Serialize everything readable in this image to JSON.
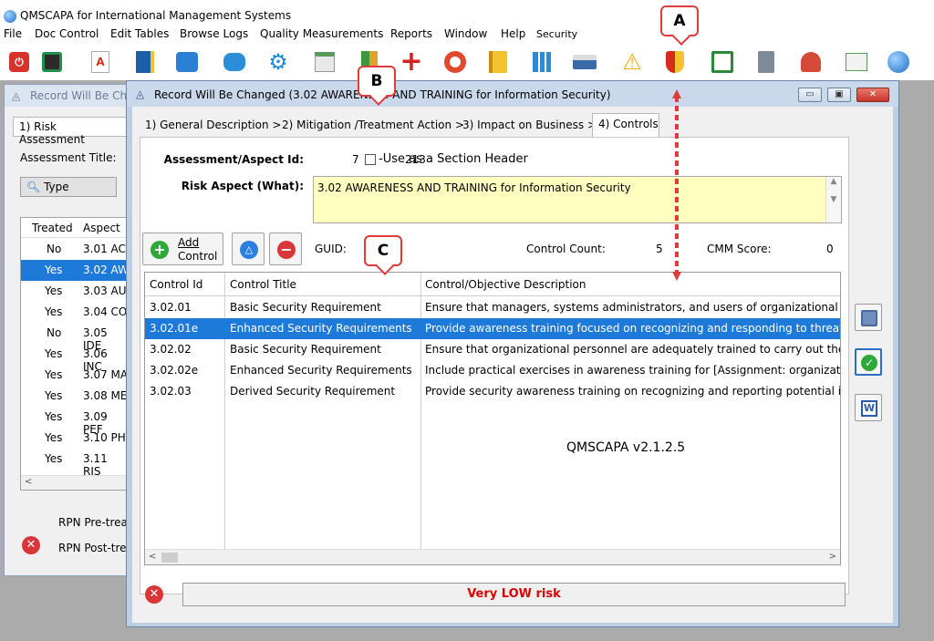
{
  "app": {
    "title": "QMSCAPA for International Management Systems",
    "version": "QMSCAPA v2.1.2.5"
  },
  "menu": [
    {
      "label": "File"
    },
    {
      "label": "Doc Control"
    },
    {
      "label": "Edit Tables"
    },
    {
      "label": "Browse Logs"
    },
    {
      "label": "Quality Measurements"
    },
    {
      "label": "Reports"
    },
    {
      "label": "Window"
    },
    {
      "label": "Help"
    },
    {
      "label": "Security"
    }
  ],
  "toolbar_icons": [
    "power-icon",
    "document-list-icon",
    "pdf-icon",
    "notebook-icon",
    "org-chart-icon",
    "chat-icon",
    "gear-icon",
    "calendar-icon",
    "books-icon",
    "red-cross-icon",
    "lifebuoy-icon",
    "notepad-icon",
    "bar-chart-icon",
    "printer-icon",
    "warning-icon",
    "shield-icon",
    "checklist-icon",
    "server-icon",
    "user-icon",
    "line-chart-icon",
    "globe-icon"
  ],
  "back_window": {
    "title": "Record Will Be Chan",
    "tab": "1) Risk Assessment",
    "assessment_title_label": "Assessment Title:",
    "type_button": "Type",
    "columns": [
      "Treated",
      "Aspect"
    ],
    "rows": [
      {
        "treated": "No",
        "aspect": "3.01 AC"
      },
      {
        "treated": "Yes",
        "aspect": "3.02 AW"
      },
      {
        "treated": "Yes",
        "aspect": "3.03 AU"
      },
      {
        "treated": "Yes",
        "aspect": "3.04 CO"
      },
      {
        "treated": "No",
        "aspect": "3.05 IDE"
      },
      {
        "treated": "Yes",
        "aspect": "3.06 INC"
      },
      {
        "treated": "Yes",
        "aspect": "3.07 MA"
      },
      {
        "treated": "Yes",
        "aspect": "3.08 ME"
      },
      {
        "treated": "Yes",
        "aspect": "3.09 PEF"
      },
      {
        "treated": "Yes",
        "aspect": "3.10 PH"
      },
      {
        "treated": "Yes",
        "aspect": "3.11 RIS"
      }
    ],
    "rpn_pre": "RPN Pre-trea",
    "rpn_post": "RPN Post-tre"
  },
  "front_window": {
    "title": "Record Will Be Changed  (3.02 AWARENESS AND TRAINING for Information Security)",
    "tabs": [
      {
        "label": "1) General Description >"
      },
      {
        "label": "2) Mitigation /Treatment Action >"
      },
      {
        "label": "3) Impact on Business >"
      },
      {
        "label": "4) Controls"
      }
    ],
    "assessment_id_label": "Assessment/Aspect Id:",
    "assessment_id": "7",
    "aspect_id": "213",
    "section_header_label": "-Use as a Section Header",
    "risk_aspect_label": "Risk Aspect (What):",
    "risk_aspect_value": "3.02 AWARENESS AND TRAINING for Information Security",
    "add_control_line1": "Add",
    "add_control_line2": "Control",
    "guid_label": "GUID:",
    "control_count_label": "Control Count:",
    "control_count": "5",
    "cmm_score_label": "CMM Score:",
    "cmm_score": "0",
    "grid_columns": [
      "Control Id",
      "Control Title",
      "Control/Objective Description"
    ],
    "grid_rows": [
      {
        "id": "3.02.01",
        "title": "Basic Security Requirement",
        "desc": "Ensure that managers, systems administrators, and users of organizational info"
      },
      {
        "id": "3.02.01e",
        "title": "Enhanced Security Requirements",
        "desc": "Provide awareness training focused on recognizing and responding to threats"
      },
      {
        "id": "3.02.02",
        "title": "Basic Security Requirement",
        "desc": "Ensure that organizational personnel are adequately trained to carry out their a"
      },
      {
        "id": "3.02.02e",
        "title": "Enhanced Security Requirements",
        "desc": "Include practical exercises in awareness training for [Assignment: organization"
      },
      {
        "id": "3.02.03",
        "title": "Derived Security Requirement",
        "desc": "Provide security awareness training on recognizing and reporting potential ind"
      }
    ],
    "status": "Very LOW risk"
  },
  "callouts": {
    "a": "A",
    "b": "B",
    "c": "C"
  },
  "colors": {
    "selection": "#1e7ad8",
    "status_text": "#e00000",
    "callout_border": "#e03a3a",
    "aspect_bg": "#ffffc0"
  }
}
